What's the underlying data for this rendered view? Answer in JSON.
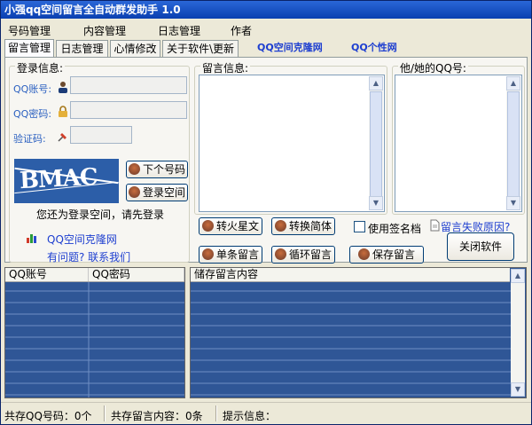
{
  "window": {
    "title": "小强qq空间留言全自动群发助手 1.0"
  },
  "menu": {
    "items": [
      "号码管理",
      "内容管理",
      "日志管理",
      "作者"
    ]
  },
  "tabs": [
    "留言管理",
    "日志管理",
    "心情修改",
    "关于软件\\更新"
  ],
  "top_links": {
    "clone": "QQ空间克隆网",
    "personal": "QQ个性网"
  },
  "login": {
    "group_title": "登录信息:",
    "qq_label": "QQ账号:",
    "pwd_label": "QQ密码:",
    "code_label": "验证码:",
    "qq_value": "",
    "pwd_value": "",
    "code_value": "",
    "captcha_text": "BMAC",
    "next_button": "下个号码",
    "login_button": "登录空间",
    "notice": "您还为登录空间，请先登录",
    "clone_link": "QQ空间克隆网",
    "contact_link": "有问题? 联系我们"
  },
  "message": {
    "group_title": "留言信息:",
    "target_title": "他/她的QQ号:",
    "btn_mars": "转火星文",
    "btn_simplified": "转换简体",
    "sign_checkbox": "使用签名档",
    "sign_checked": false,
    "fail_link": "留言失败原因?",
    "btn_single": "单条留言",
    "btn_loop": "循环留言",
    "btn_save": "保存留言",
    "btn_close": "关闭软件"
  },
  "grid_left": {
    "columns": [
      "QQ账号",
      "QQ密码"
    ]
  },
  "grid_right": {
    "columns": [
      "储存留言内容"
    ]
  },
  "status": {
    "qq_count": "共存QQ号码：0个",
    "msg_count": "共存留言内容：0条",
    "hint": "提示信息："
  },
  "colors": {
    "title_bar": "#0a3fb0",
    "grid_bg": "#2f5696",
    "link": "#1e3fd0"
  }
}
